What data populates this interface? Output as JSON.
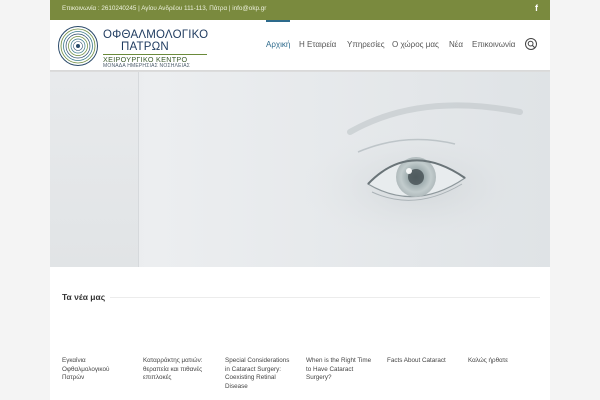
{
  "topbar": {
    "contact_text": "Επικοινωνία : 2610240245 | Αγίου Ανδρέου 111-113, Πάτρα | info@okp.gr",
    "facebook_icon": "facebook-icon"
  },
  "logo": {
    "line1": "ΟΦΘΑΛΜΟΛΟΓΙΚΟ",
    "line2": "ΠΑΤΡΩΝ",
    "line3": "ΧΕΙΡΟΥΡΓΙΚΟ ΚΕΝΤΡΟ",
    "line4": "ΜΟΝΑΔΑ ΗΜΕΡΗΣΙΑΣ ΝΟΣΗΛΕΙΑΣ"
  },
  "nav": {
    "items": [
      {
        "label": "Αρχική",
        "active": true
      },
      {
        "label": "Η Εταιρεία",
        "active": false
      },
      {
        "label": "Υπηρεσίες",
        "active": false
      },
      {
        "label": "Ο χώρος μας",
        "active": false
      },
      {
        "label": "Νέα",
        "active": false
      },
      {
        "label": "Επικοινωνία",
        "active": false
      }
    ],
    "search_icon": "search-icon"
  },
  "news": {
    "title": "Τα νέα μας",
    "items": [
      {
        "title": "Εγκαίνια Οφθαλμολογικού Πατρών"
      },
      {
        "title": "Καταρράκτης ματιών: θεραπεία και πιθανές επιπλοκές"
      },
      {
        "title": "Special Considerations in Cataract Surgery: Coexisting Retinal Disease"
      },
      {
        "title": "When is the Right Time to Have Cataract Surgery?"
      },
      {
        "title": "Facts About Cataract"
      },
      {
        "title": "Καλώς ήρθατε"
      }
    ]
  },
  "colors": {
    "topbar": "#7a8a3e",
    "accent": "#2d6a8c",
    "logo_text": "#1e3a5f"
  }
}
